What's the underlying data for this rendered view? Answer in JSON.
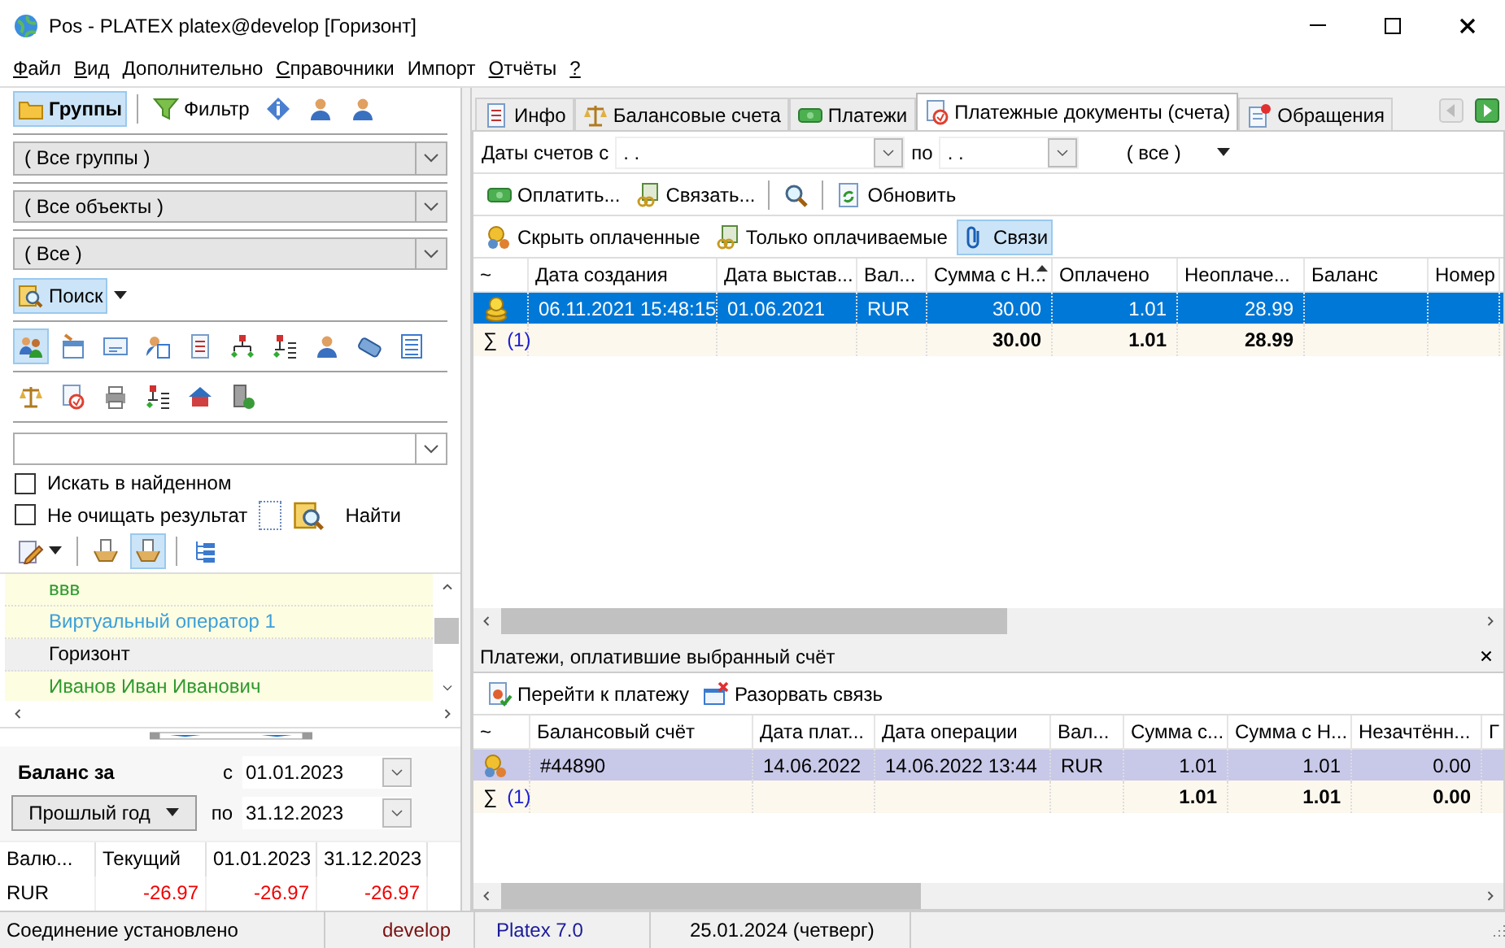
{
  "window": {
    "title": "Pos - PLATEX platex@develop [Горизонт]"
  },
  "menu": [
    {
      "label": "Файл",
      "mnemonic": true
    },
    {
      "label": "Вид",
      "mnemonic": true
    },
    {
      "label": "Дополнительно",
      "mnemonic": true
    },
    {
      "label": "Справочники",
      "mnemonic": true
    },
    {
      "label": "Импорт",
      "mnemonic": false
    },
    {
      "label": "Отчёты",
      "mnemonic": true
    },
    {
      "label": "?",
      "mnemonic": true
    }
  ],
  "left_panel": {
    "toolbar": [
      {
        "label": "Группы",
        "selected": true
      },
      {
        "label": "Фильтр",
        "selected": false
      }
    ],
    "filters": [
      {
        "value": "( Все группы )"
      },
      {
        "value": "( Все объекты )"
      },
      {
        "value": "( Все )"
      }
    ],
    "search_button": {
      "label": "Поиск"
    },
    "object_icons": [
      {
        "selected": true
      },
      {
        "selected": false
      },
      {
        "selected": false
      },
      {
        "selected": false
      },
      {
        "selected": false
      },
      {
        "selected": false
      },
      {
        "selected": false
      },
      {
        "selected": false
      },
      {
        "selected": false
      },
      {
        "selected": false
      }
    ],
    "options": [
      {
        "label": "Искать в найденном",
        "checked": false
      },
      {
        "label": "Не очищать результат",
        "checked": false
      }
    ],
    "find_button": {
      "label": "Найти"
    },
    "list_toolbar": [
      {
        "selected": false
      },
      {
        "selected": true
      }
    ],
    "list": [
      {
        "text": "ввв",
        "color": "#2e9a2e",
        "selected": false
      },
      {
        "text": "Виртуальный оператор 1",
        "color": "#3c9fd8",
        "selected": false
      },
      {
        "text": "Горизонт",
        "color": "#000000",
        "selected": true
      },
      {
        "text": "Иванов Иван Иванович",
        "color": "#2e9a2e",
        "selected": false
      }
    ],
    "balance": {
      "title": "Баланс за",
      "from_label": "с",
      "from": "01.01.2023",
      "period": "Прошлый год",
      "to_label": "по",
      "to": "31.12.2023",
      "columns": [
        "Валю...",
        "Текущий",
        "01.01.2023",
        "31.12.2023"
      ],
      "rows": [
        {
          "cells": [
            {
              "text": "RUR",
              "negative": false
            },
            {
              "text": "-26.97",
              "negative": true
            },
            {
              "text": "-26.97",
              "negative": true
            },
            {
              "text": "-26.97",
              "negative": true
            }
          ]
        }
      ]
    }
  },
  "tabs": [
    {
      "label": "Инфо",
      "selected": false
    },
    {
      "label": "Балансовые счета",
      "selected": false
    },
    {
      "label": "Платежи",
      "selected": false
    },
    {
      "label": "Платежные документы (счета)",
      "selected": true
    },
    {
      "label": "Обращения",
      "selected": false
    }
  ],
  "filter_bar": {
    "label": "Даты счетов с",
    "from": ". .",
    "to_label": "по",
    "to": ". .",
    "status": "( все )"
  },
  "toolbar": [
    {
      "kind": "button",
      "label": "Оплатить..."
    },
    {
      "kind": "button",
      "label": "Связать..."
    },
    {
      "kind": "icon"
    },
    {
      "kind": "button",
      "label": "Обновить"
    }
  ],
  "toolbar_2": [
    {
      "label": "Скрыть оплаченные",
      "selected": false
    },
    {
      "label": "Только оплачиваемые",
      "selected": false
    },
    {
      "label": "Связи",
      "selected": true
    }
  ],
  "invoices": {
    "focused": true,
    "columns": [
      {
        "label": "~",
        "sorted": false
      },
      {
        "label": "Дата создания",
        "sorted": false
      },
      {
        "label": "Дата выстав...",
        "sorted": false
      },
      {
        "label": "Вал...",
        "sorted": false
      },
      {
        "label": "Сумма с Н...",
        "sorted": true
      },
      {
        "label": "Оплачено",
        "sorted": false
      },
      {
        "label": "Неоплаче...",
        "sorted": false
      },
      {
        "label": "Баланс",
        "sorted": false
      },
      {
        "label": "Номер",
        "sorted": false
      }
    ],
    "rows": [
      {
        "selected": true,
        "cells": [
          "",
          "06.11.2021 15:48:15",
          "01.06.2021",
          "RUR",
          "30.00",
          "1.01",
          "28.99",
          null,
          null
        ]
      }
    ],
    "total": {
      "sigma": "∑",
      "count": "(1)",
      "cells": [
        null,
        null,
        null,
        "30.00",
        "1.01",
        "28.99",
        null,
        null
      ]
    }
  },
  "payments_panel": {
    "title": "Платежи, оплатившие выбранный счёт",
    "toolbar": [
      {
        "label": "Перейти к платежу"
      },
      {
        "label": "Разорвать связь"
      }
    ],
    "focused": false,
    "columns": [
      {
        "label": "~"
      },
      {
        "label": "Балансовый счёт"
      },
      {
        "label": "Дата плат..."
      },
      {
        "label": "Дата операции"
      },
      {
        "label": "Вал..."
      },
      {
        "label": "Сумма с..."
      },
      {
        "label": "Сумма с Н..."
      },
      {
        "label": "Незачтённ..."
      },
      {
        "label": "Г"
      }
    ],
    "rows": [
      {
        "selected": true,
        "cells": [
          "",
          "#44890",
          "14.06.2022",
          "14.06.2022 13:44",
          "RUR",
          "1.01",
          "1.01",
          "0.00",
          null
        ]
      }
    ],
    "total": {
      "sigma": "∑",
      "count": "(1)",
      "cells": [
        null,
        null,
        null,
        null,
        "1.01",
        "1.01",
        "0.00",
        null
      ]
    }
  },
  "status_bar": [
    "Соединение установлено",
    "develop",
    "Platex 7.0",
    "25.01.2024 (четверг)"
  ]
}
